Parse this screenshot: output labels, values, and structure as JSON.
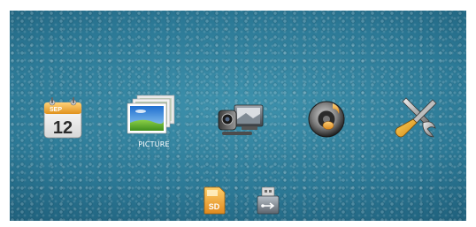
{
  "menu": {
    "items": [
      {
        "id": "calendar",
        "icon": "calendar-icon",
        "calendar": {
          "month": "SEP",
          "day": "12"
        }
      },
      {
        "id": "picture",
        "icon": "picture-icon",
        "label": "PICTURE",
        "selected": true
      },
      {
        "id": "video",
        "icon": "video-camera-icon"
      },
      {
        "id": "music",
        "icon": "music-speaker-icon"
      },
      {
        "id": "settings",
        "icon": "wrench-screwdriver-icon"
      }
    ]
  },
  "storage": {
    "items": [
      {
        "id": "sd",
        "icon": "sd-card-icon",
        "text": "SD"
      },
      {
        "id": "usb",
        "icon": "usb-drive-icon"
      }
    ]
  },
  "colors": {
    "background": "#2c7996",
    "accent": "#e8a53a",
    "label": "#ffffff"
  }
}
